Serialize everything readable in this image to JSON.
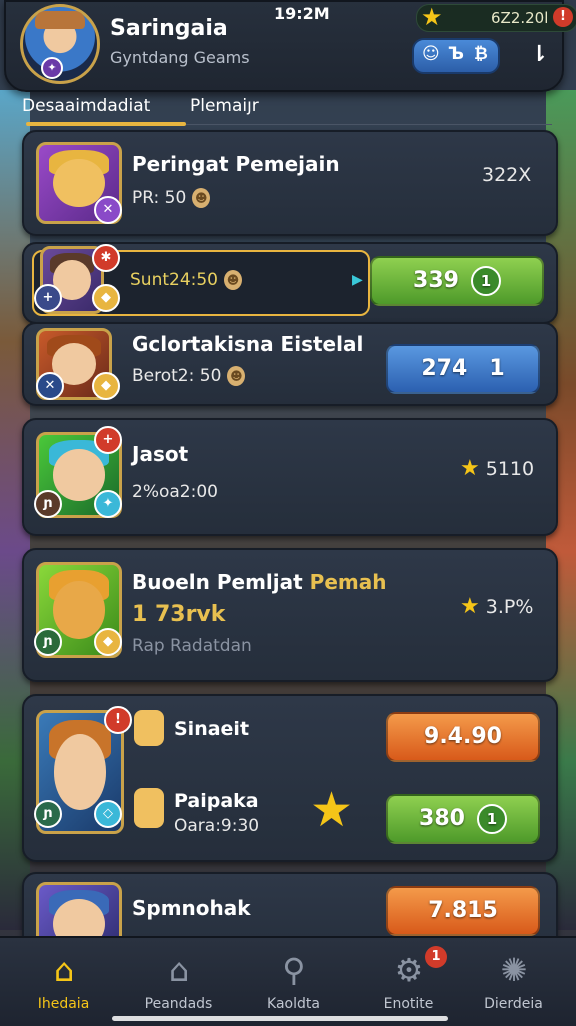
{
  "status": {
    "time": "19:2M",
    "currency": "6Z2.20l",
    "alert": "!"
  },
  "header": {
    "title": "Saringaia",
    "subtitle": "Gyntdang Geams",
    "pill_left": "☺",
    "pill_mid": "Ъ",
    "pill_right": "₿",
    "link_icon": "⇂"
  },
  "tabs": [
    {
      "label": "Desaaimdadiat",
      "active": true
    },
    {
      "label": "Plemaiյr",
      "active": false
    }
  ],
  "cards": [
    {
      "name": "Peringat Pemejain",
      "sub": "PR: 50",
      "right": "322X",
      "portrait": "purple"
    },
    {
      "name": "",
      "sub": "Sunt24:50",
      "button": "339",
      "button_ring": "1",
      "button_color": "green",
      "portrait": "purple"
    },
    {
      "name": "Gclortakisna Eistelal",
      "sub": "Berot2: 50",
      "button": "274",
      "button_ring": "1",
      "button_color": "blue",
      "portrait": "blue"
    },
    {
      "name": "Jasot",
      "sub": "2%oa2:00",
      "right": "5110",
      "portrait": "green"
    },
    {
      "name_a": "Buoeln Pemljat",
      "name_b": "Pemah",
      "sub": "1 73rvk",
      "sub2": "Rap Radatdan",
      "right": "3.P%",
      "portrait": "green"
    },
    {
      "row1_name": "Sinaeit",
      "row1_button": "9.4.90",
      "row2_name": "Paipaka",
      "row2_sub": "Oara:9:30",
      "row2_button": "380",
      "row2_ring": "1"
    },
    {
      "name": "Spmnohak",
      "button": "7.815"
    }
  ],
  "nav": [
    {
      "label": "Ihedaia",
      "icon": "home-icon",
      "active": true
    },
    {
      "label": "Peandads",
      "icon": "house-icon",
      "active": false
    },
    {
      "label": "Kaoldta",
      "icon": "search-icon",
      "active": false
    },
    {
      "label": "Enotite",
      "icon": "gear-icon",
      "active": false,
      "badge": "1"
    },
    {
      "label": "Dierdeia",
      "icon": "cog-icon",
      "active": false
    }
  ],
  "colors": {
    "accent": "#e8b540",
    "green": "#6ab83a",
    "blue": "#3a78c8",
    "orange": "#e8742a"
  }
}
